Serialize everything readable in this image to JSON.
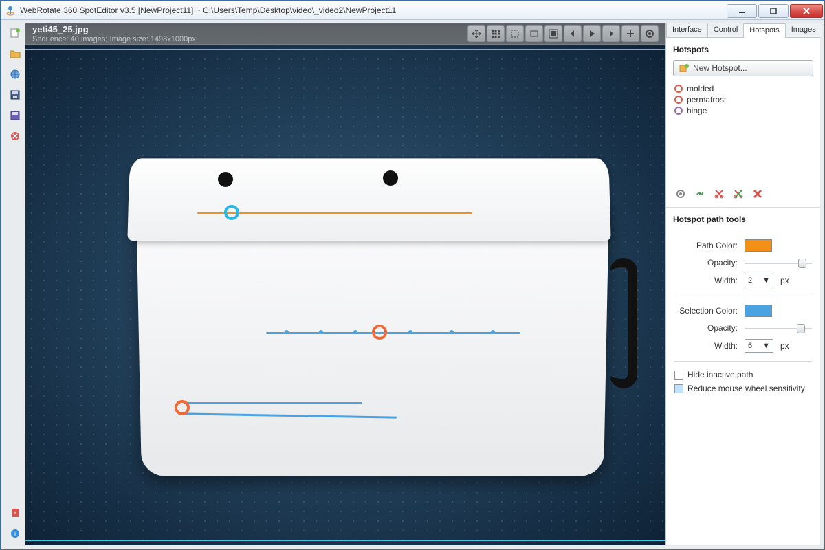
{
  "window": {
    "title": "WebRotate 360 SpotEditor v3.5 [NewProject11] ~ C:\\Users\\Temp\\Desktop\\video\\_video2\\NewProject11"
  },
  "canvas": {
    "filename": "yeti45_25.jpg",
    "meta": "Sequence: 40 images; Image size: 1498x1000px"
  },
  "tabs": [
    "Interface",
    "Control",
    "Hotspots",
    "Images"
  ],
  "active_tab": "Hotspots",
  "hotspots": {
    "heading": "Hotspots",
    "new_button": "New Hotspot...",
    "items": [
      {
        "name": "molded",
        "color": "red"
      },
      {
        "name": "permafrost",
        "color": "red"
      },
      {
        "name": "hinge",
        "color": "purple"
      }
    ]
  },
  "path_tools": {
    "heading": "Hotspot path tools",
    "path_color_label": "Path Color:",
    "path_color": "#f29018",
    "path_opacity_label": "Opacity:",
    "path_width_label": "Width:",
    "path_width_value": "2",
    "px": "px",
    "sel_color_label": "Selection Color:",
    "sel_color": "#4aa3e0",
    "sel_opacity_label": "Opacity:",
    "sel_width_label": "Width:",
    "sel_width_value": "6",
    "hide_inactive": "Hide inactive path",
    "reduce_wheel": "Reduce mouse wheel sensitivity"
  }
}
